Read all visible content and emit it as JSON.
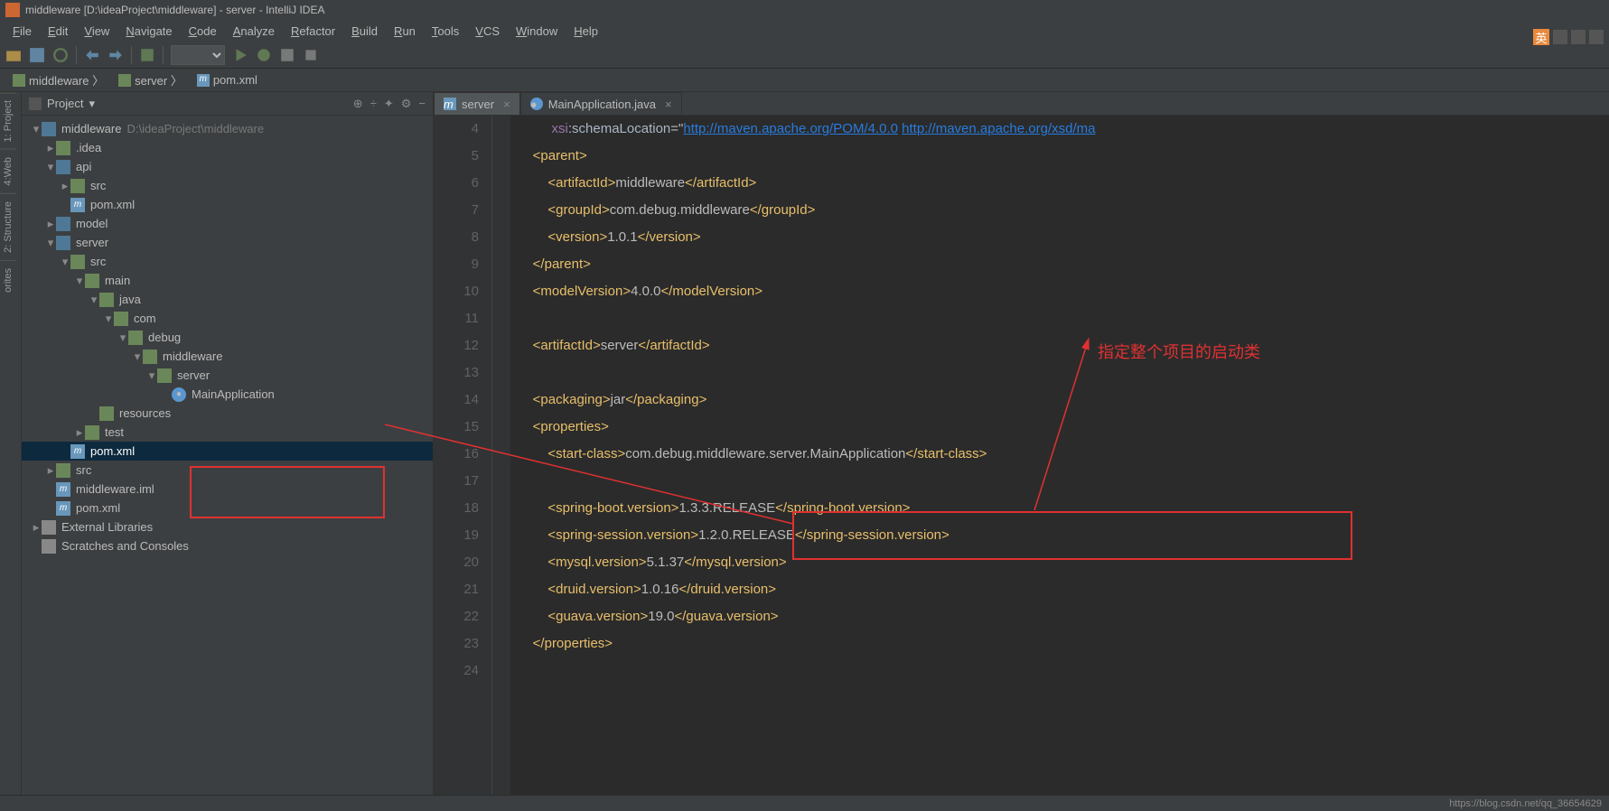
{
  "window_title": "middleware [D:\\ideaProject\\middleware] - server - IntelliJ IDEA",
  "menu": [
    "File",
    "Edit",
    "View",
    "Navigate",
    "Code",
    "Analyze",
    "Refactor",
    "Build",
    "Run",
    "Tools",
    "VCS",
    "Window",
    "Help"
  ],
  "breadcrumbs": [
    {
      "icon": "mod",
      "label": "middleware"
    },
    {
      "icon": "mod",
      "label": "server"
    },
    {
      "icon": "file",
      "label": "pom.xml"
    }
  ],
  "project_panel": {
    "title": "Project",
    "buttons": [
      "⊕",
      "÷",
      "✦",
      "⚙",
      "−"
    ]
  },
  "tree": [
    {
      "d": 0,
      "a": "open",
      "i": "mod",
      "t": "middleware",
      "dim": "D:\\ideaProject\\middleware"
    },
    {
      "d": 1,
      "a": "closed",
      "i": "folder",
      "t": ".idea"
    },
    {
      "d": 1,
      "a": "open",
      "i": "mod",
      "t": "api"
    },
    {
      "d": 2,
      "a": "closed",
      "i": "folder",
      "t": "src"
    },
    {
      "d": 2,
      "a": "none",
      "i": "file",
      "t": "pom.xml"
    },
    {
      "d": 1,
      "a": "closed",
      "i": "mod",
      "t": "model"
    },
    {
      "d": 1,
      "a": "open",
      "i": "mod",
      "t": "server"
    },
    {
      "d": 2,
      "a": "open",
      "i": "folder",
      "t": "src"
    },
    {
      "d": 3,
      "a": "open",
      "i": "folder",
      "t": "main"
    },
    {
      "d": 4,
      "a": "open",
      "i": "folder",
      "t": "java"
    },
    {
      "d": 5,
      "a": "open",
      "i": "pkg",
      "t": "com"
    },
    {
      "d": 6,
      "a": "open",
      "i": "pkg",
      "t": "debug"
    },
    {
      "d": 7,
      "a": "open",
      "i": "pkg",
      "t": "middleware"
    },
    {
      "d": 8,
      "a": "open",
      "i": "pkg",
      "t": "server"
    },
    {
      "d": 9,
      "a": "none",
      "i": "java",
      "t": "MainApplication"
    },
    {
      "d": 4,
      "a": "none",
      "i": "folder",
      "t": "resources"
    },
    {
      "d": 3,
      "a": "closed",
      "i": "folder",
      "t": "test"
    },
    {
      "d": 2,
      "a": "none",
      "i": "file",
      "t": "pom.xml",
      "sel": true
    },
    {
      "d": 1,
      "a": "closed",
      "i": "folder",
      "t": "src"
    },
    {
      "d": 1,
      "a": "none",
      "i": "file",
      "t": "middleware.iml"
    },
    {
      "d": 1,
      "a": "none",
      "i": "file",
      "t": "pom.xml"
    },
    {
      "d": 0,
      "a": "closed",
      "i": "lib",
      "t": "External Libraries"
    },
    {
      "d": 0,
      "a": "none",
      "i": "lib",
      "t": "Scratches and Consoles"
    }
  ],
  "editor_tabs": [
    {
      "label": "server",
      "icon": "file",
      "active": true
    },
    {
      "label": "MainApplication.java",
      "icon": "java",
      "active": false
    }
  ],
  "gutter_start": 4,
  "gutter_end": 24,
  "code_lines": [
    "         xsi:schemaLocation=\"http://maven.apache.org/POM/4.0.0 http://maven.apache.org/xsd/ma",
    "    <parent>",
    "        <artifactId>middleware</artifactId>",
    "        <groupId>com.debug.middleware</groupId>",
    "        <version>1.0.1</version>",
    "    </parent>",
    "    <modelVersion>4.0.0</modelVersion>",
    "",
    "    <artifactId>server</artifactId>",
    "",
    "    <packaging>jar</packaging>",
    "    <properties>",
    "        <start-class>com.debug.middleware.server.MainApplication</start-class>",
    "",
    "        <spring-boot.version>1.3.3.RELEASE</spring-boot.version>",
    "        <spring-session.version>1.2.0.RELEASE</spring-session.version>",
    "        <mysql.version>5.1.37</mysql.version>",
    "        <druid.version>1.0.16</druid.version>",
    "        <guava.version>19.0</guava.version>",
    "    </properties>",
    ""
  ],
  "annotation": "指定整个项目的启动类",
  "tray_text": "英",
  "watermark": "https://blog.csdn.net/qq_36654629",
  "side_tabs": [
    "1: Project",
    "4:Web",
    "2: Structure",
    "orites"
  ]
}
